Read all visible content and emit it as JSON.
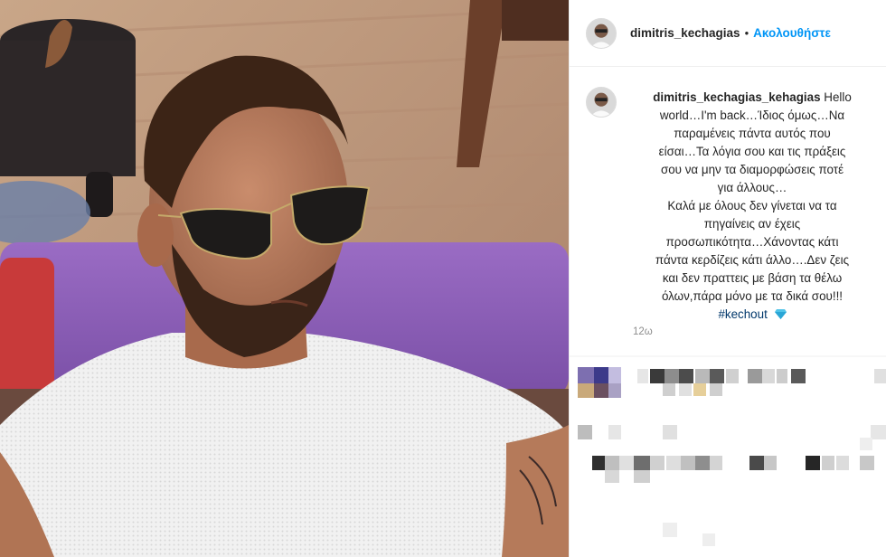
{
  "post": {
    "username": "dimitris_kechagias",
    "separator": "•",
    "follow_label": "Ακολουθήστε",
    "caption": {
      "username": "dimitris_kechagias_kehagias",
      "lines": [
        "Hello",
        "world…I'm back…Ίδιος όμως…Να",
        "παραμένεις πάντα αυτός που",
        "είσαι…Τα λόγια σου και τις πράξεις",
        "σου να μην τα διαμορφώσεις ποτέ",
        "για άλλους…",
        "Καλά με όλους δεν γίνεται να τα",
        "πηγαίνεις αν έχεις",
        "προσωπικότητα…Χάνοντας κάτι",
        "πάντα κερδίζεις κάτι άλλο….Δεν ζεις",
        "και δεν πραττεις με βάση τα θέλω",
        "όλων,πάρα μόνο με τα δικά σου!!!"
      ],
      "hashtag": "#kechout",
      "emoji_icon": "gem-icon"
    },
    "time_ago": "12ω"
  },
  "colors": {
    "link": "#0095f6",
    "hashtag": "#00376b",
    "muted": "#8e8e8e",
    "text": "#262626"
  }
}
